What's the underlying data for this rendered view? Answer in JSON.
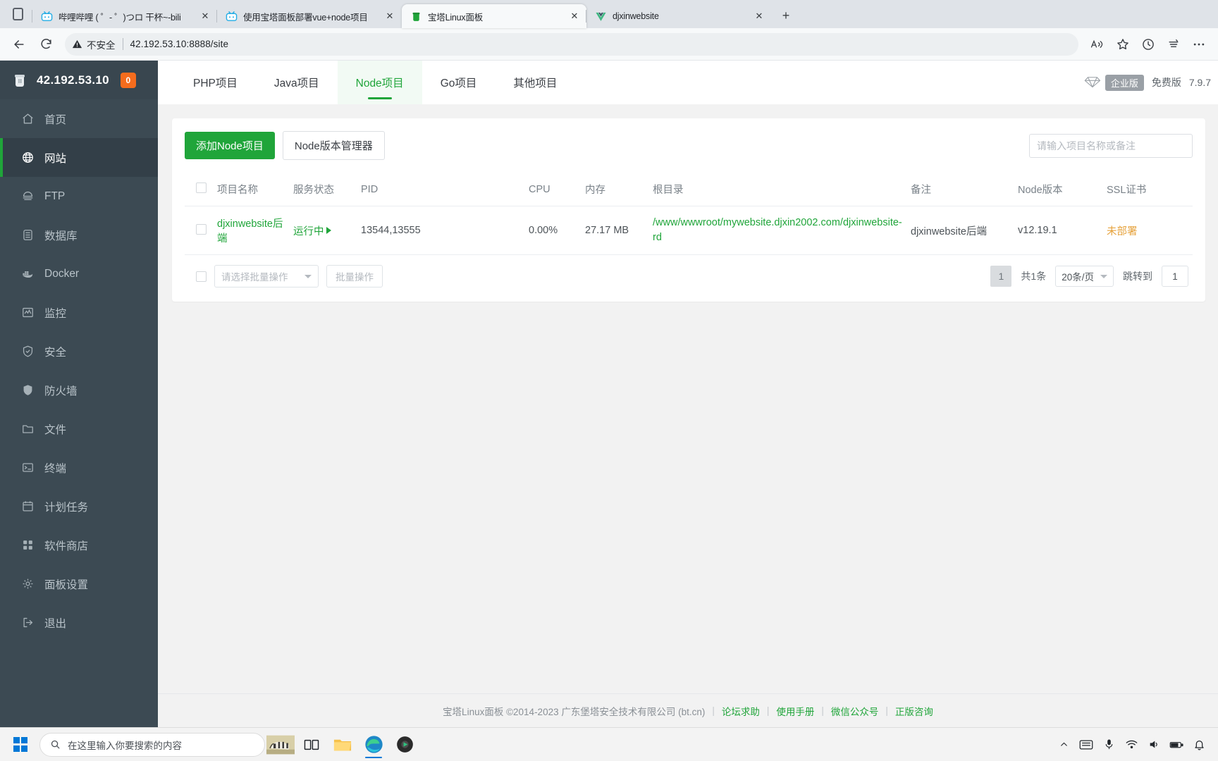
{
  "browser": {
    "tabs": [
      {
        "title": "哔哩哔哩 ( ゜- ゜)つロ 干杯~-bili",
        "favicon": "bilibili-icon",
        "active": false,
        "close_label": "✕"
      },
      {
        "title": "使用宝塔面板部署vue+node项目",
        "favicon": "bilibili-icon",
        "active": false,
        "close_label": "✕"
      },
      {
        "title": "宝塔Linux面板",
        "favicon": "bt-panel-icon",
        "active": true,
        "close_label": "✕"
      },
      {
        "title": "djxinwebsite",
        "favicon": "vue-icon",
        "active": false,
        "close_label": "✕"
      }
    ],
    "new_tab_label": "+",
    "toolbar": {
      "back_label": "←",
      "reload_label": "⟳",
      "security_text": "不安全",
      "url": "42.192.53.10:8888/site"
    }
  },
  "sidebar": {
    "ip": "42.192.53.10",
    "badge": "0",
    "items": [
      {
        "label": "首页",
        "icon": "home-icon",
        "active": false
      },
      {
        "label": "网站",
        "icon": "globe-icon",
        "active": true
      },
      {
        "label": "FTP",
        "icon": "ftp-icon",
        "active": false
      },
      {
        "label": "数据库",
        "icon": "database-icon",
        "active": false
      },
      {
        "label": "Docker",
        "icon": "docker-icon",
        "active": false
      },
      {
        "label": "监控",
        "icon": "monitor-icon",
        "active": false
      },
      {
        "label": "安全",
        "icon": "shield-check-icon",
        "active": false
      },
      {
        "label": "防火墙",
        "icon": "shield-icon",
        "active": false
      },
      {
        "label": "文件",
        "icon": "folder-icon",
        "active": false
      },
      {
        "label": "终端",
        "icon": "terminal-icon",
        "active": false
      },
      {
        "label": "计划任务",
        "icon": "calendar-icon",
        "active": false
      },
      {
        "label": "软件商店",
        "icon": "grid-icon",
        "active": false
      },
      {
        "label": "面板设置",
        "icon": "gear-icon",
        "active": false
      },
      {
        "label": "退出",
        "icon": "logout-icon",
        "active": false
      }
    ]
  },
  "main": {
    "tabs": [
      {
        "label": "PHP项目",
        "active": false
      },
      {
        "label": "Java项目",
        "active": false
      },
      {
        "label": "Node项目",
        "active": true
      },
      {
        "label": "Go项目",
        "active": false
      },
      {
        "label": "其他项目",
        "active": false
      }
    ],
    "version": {
      "enterprise_label": "企业版",
      "edition": "免费版",
      "number": "7.9.7"
    },
    "toolbar": {
      "add_button": "添加Node项目",
      "version_manager_button": "Node版本管理器",
      "search_placeholder": "请输入项目名称或备注"
    },
    "table": {
      "columns": [
        "项目名称",
        "服务状态",
        "PID",
        "CPU",
        "内存",
        "根目录",
        "备注",
        "Node版本",
        "SSL证书"
      ],
      "rows": [
        {
          "name": "djxinwebsite后端",
          "status": "运行中",
          "pid": "13544,13555",
          "cpu": "0.00%",
          "memory": "27.17 MB",
          "root_dir": "/www/wwwroot/mywebsite.djxin2002.com/djxinwebsite-rd",
          "note": "djxinwebsite后端",
          "node_version": "v12.19.1",
          "ssl": "未部署"
        }
      ]
    },
    "batch": {
      "select_placeholder": "请选择批量操作",
      "action_button": "批量操作"
    },
    "pagination": {
      "current_page": "1",
      "total_text": "共1条",
      "page_size": "20条/页",
      "jump_label": "跳转到",
      "jump_value": "1"
    },
    "footer": {
      "copyright": "宝塔Linux面板 ©2014-2023 广东堡塔安全技术有限公司 (bt.cn)",
      "links": [
        "论坛求助",
        "使用手册",
        "微信公众号",
        "正版咨询"
      ],
      "separator": "|"
    }
  },
  "taskbar": {
    "search_placeholder": "在这里输入你要搜索的内容",
    "apps": [
      {
        "name": "zebra-wallpaper-icon"
      },
      {
        "name": "task-view-icon"
      },
      {
        "name": "file-explorer-icon"
      },
      {
        "name": "edge-browser-icon"
      },
      {
        "name": "media-player-icon"
      }
    ],
    "tray": [
      {
        "name": "show-hidden-icons-chevron"
      },
      {
        "name": "input-method-icon"
      },
      {
        "name": "microphone-icon"
      },
      {
        "name": "network-icon"
      },
      {
        "name": "volume-icon"
      },
      {
        "name": "battery-icon"
      },
      {
        "name": "notification-icon"
      }
    ]
  }
}
